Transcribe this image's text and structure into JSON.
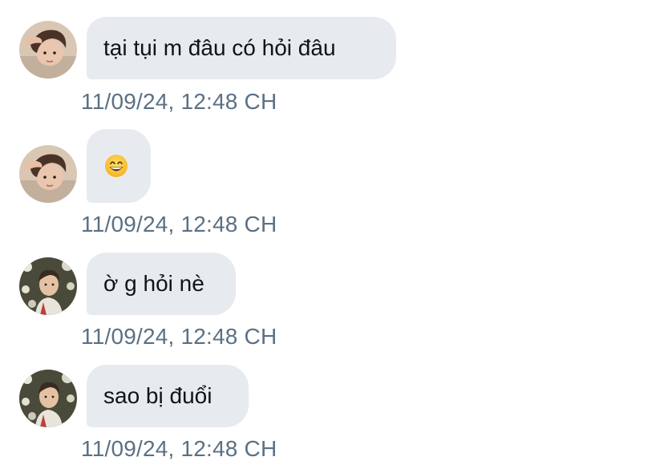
{
  "conversation": {
    "messages": [
      {
        "sender_avatar": "avatar-girl-icon",
        "text": "tại tụi m đâu có hỏi đâu",
        "timestamp": "11/09/24, 12:48 CH"
      },
      {
        "sender_avatar": "avatar-girl-icon",
        "text": "",
        "emoji": "grinning-face-with-smiling-eyes-icon",
        "timestamp": "11/09/24, 12:48 CH"
      },
      {
        "sender_avatar": "avatar-boy-icon",
        "text": "ờ g hỏi nè",
        "timestamp": "11/09/24, 12:48 CH"
      },
      {
        "sender_avatar": "avatar-boy-icon",
        "text": "sao bị đuổi",
        "timestamp": "11/09/24, 12:48 CH"
      }
    ]
  },
  "colors": {
    "bubble_background": "#e7ebef",
    "message_text": "#0f1419",
    "timestamp_text": "#5b7083",
    "page_background": "#ffffff"
  }
}
